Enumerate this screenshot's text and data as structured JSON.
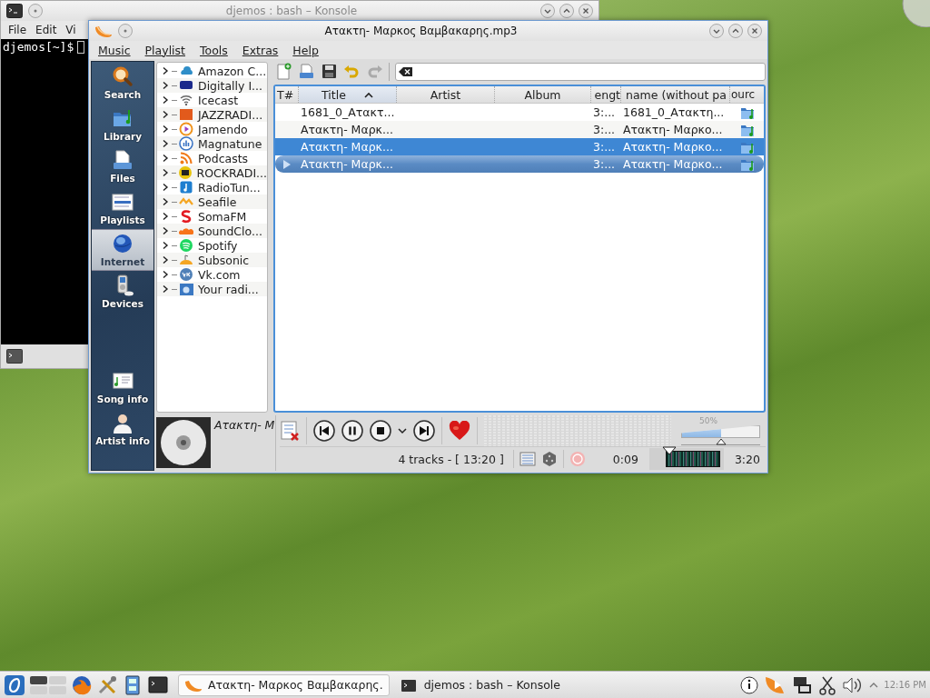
{
  "konsole": {
    "title": "djemos : bash – Konsole",
    "menu": [
      "File",
      "Edit",
      "Vi"
    ],
    "prompt": "djemos[~]$"
  },
  "player": {
    "title": "Ατακτη- Μαρκος Βαμβακαρης.mp3",
    "menu": [
      "Music",
      "Playlist",
      "Tools",
      "Extras",
      "Help"
    ],
    "sidebar": [
      {
        "label": "Search",
        "selected": false
      },
      {
        "label": "Library",
        "selected": false
      },
      {
        "label": "Files",
        "selected": false
      },
      {
        "label": "Playlists",
        "selected": false
      },
      {
        "label": "Internet",
        "selected": true
      },
      {
        "label": "Devices",
        "selected": false
      },
      {
        "label": "Song info",
        "selected": false
      },
      {
        "label": "Artist info",
        "selected": false
      }
    ],
    "services": [
      "Amazon C...",
      "Digitally I...",
      "Icecast",
      "JAZZRADI...",
      "Jamendo",
      "Magnatune",
      "Podcasts",
      "ROCKRADI...",
      "RadioTun...",
      "Seafile",
      "SomaFM",
      "SoundClo...",
      "Spotify",
      "Subsonic",
      "Vk.com",
      "Your radi..."
    ],
    "columns": [
      {
        "label": "T#",
        "sorted": false
      },
      {
        "label": "Title",
        "sorted": true
      },
      {
        "label": "Artist",
        "sorted": false
      },
      {
        "label": "Album",
        "sorted": false
      },
      {
        "label": "engt",
        "sorted": false
      },
      {
        "label": "name (without pa",
        "sorted": false
      },
      {
        "label": "ourc",
        "sorted": false
      }
    ],
    "rows": [
      {
        "title": "1681_0_Ατακτ...",
        "length": "3:...",
        "filename": "1681_0_Ατακτη...",
        "selected": false,
        "playing": false
      },
      {
        "title": "Ατακτη- Μαρκ...",
        "length": "3:...",
        "filename": "Ατακτη- Μαρκο...",
        "selected": false,
        "playing": false
      },
      {
        "title": "Ατακτη- Μαρκ...",
        "length": "3:...",
        "filename": "Ατακτη- Μαρκο...",
        "selected": true,
        "playing": false
      },
      {
        "title": "Ατακτη- Μαρκ...",
        "length": "3:...",
        "filename": "Ατακτη- Μαρκο...",
        "selected": false,
        "playing": true
      }
    ],
    "now_playing": "Ατακτη- Μ",
    "volume": {
      "reading": "50%",
      "level": 0.5
    },
    "status": "4 tracks - [ 13:20 ]",
    "elapsed": "0:09",
    "progress": {
      "level": 0.045
    },
    "total": "3:20"
  },
  "taskbar": {
    "tasks": [
      {
        "label": "Ατακτη- Μαρκος Βαμβακαρης.",
        "selected": true
      },
      {
        "label": "djemos : bash – Konsole",
        "selected": false
      }
    ],
    "clock": "12:16 PM"
  }
}
